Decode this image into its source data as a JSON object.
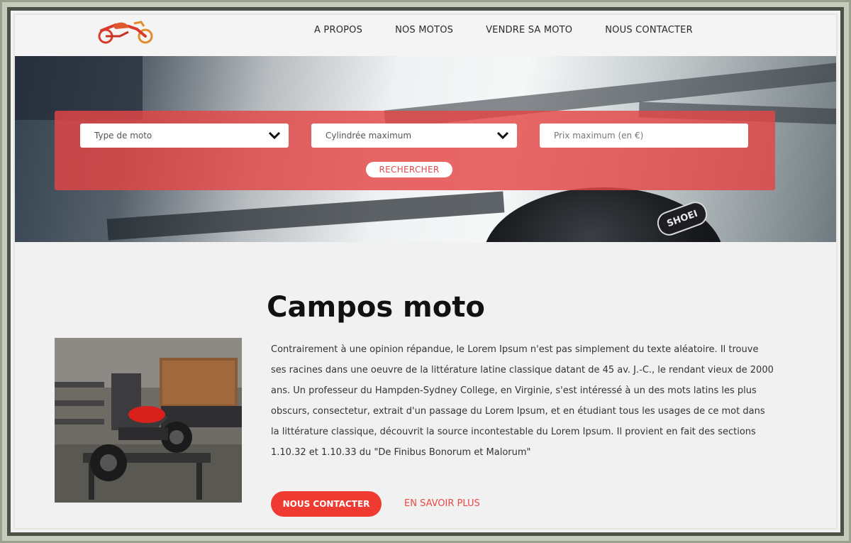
{
  "header": {
    "logo_name": "motorcycle-logo",
    "nav": [
      {
        "label": "A PROPOS"
      },
      {
        "label": "NOS MOTOS"
      },
      {
        "label": "VENDRE SA MOTO"
      },
      {
        "label": "NOUS CONTACTER"
      }
    ]
  },
  "hero": {
    "helmet_text": "SHOEI"
  },
  "search": {
    "type_select": "Type de moto",
    "cylinder_select": "Cylindrée maximum",
    "price_placeholder": "Prix maximum (en €)",
    "button_label": "RECHERCHER"
  },
  "content": {
    "title": "Campos moto",
    "paragraph": "Contrairement à une opinion répandue, le Lorem Ipsum n'est pas simplement du texte aléatoire. Il trouve ses racines dans une oeuvre de la littérature latine classique datant de 45 av. J.-C., le rendant vieux de 2000 ans. Un professeur du Hampden-Sydney College, en Virginie, s'est intéressé à un des mots latins les plus obscurs, consectetur, extrait d'un passage du Lorem Ipsum, et en étudiant tous les usages de ce mot dans la littérature classique, découvrit la source incontestable du Lorem Ipsum. Il provient en fait des sections 1.10.32 et 1.10.33 du \"De Finibus Bonorum et Malorum\"",
    "contact_button": "NOUS CONTACTER",
    "more_link": "EN SAVOIR PLUS"
  },
  "colors": {
    "accent": "#ee3a30",
    "panel": "#e44646",
    "link": "#ea4a45"
  }
}
